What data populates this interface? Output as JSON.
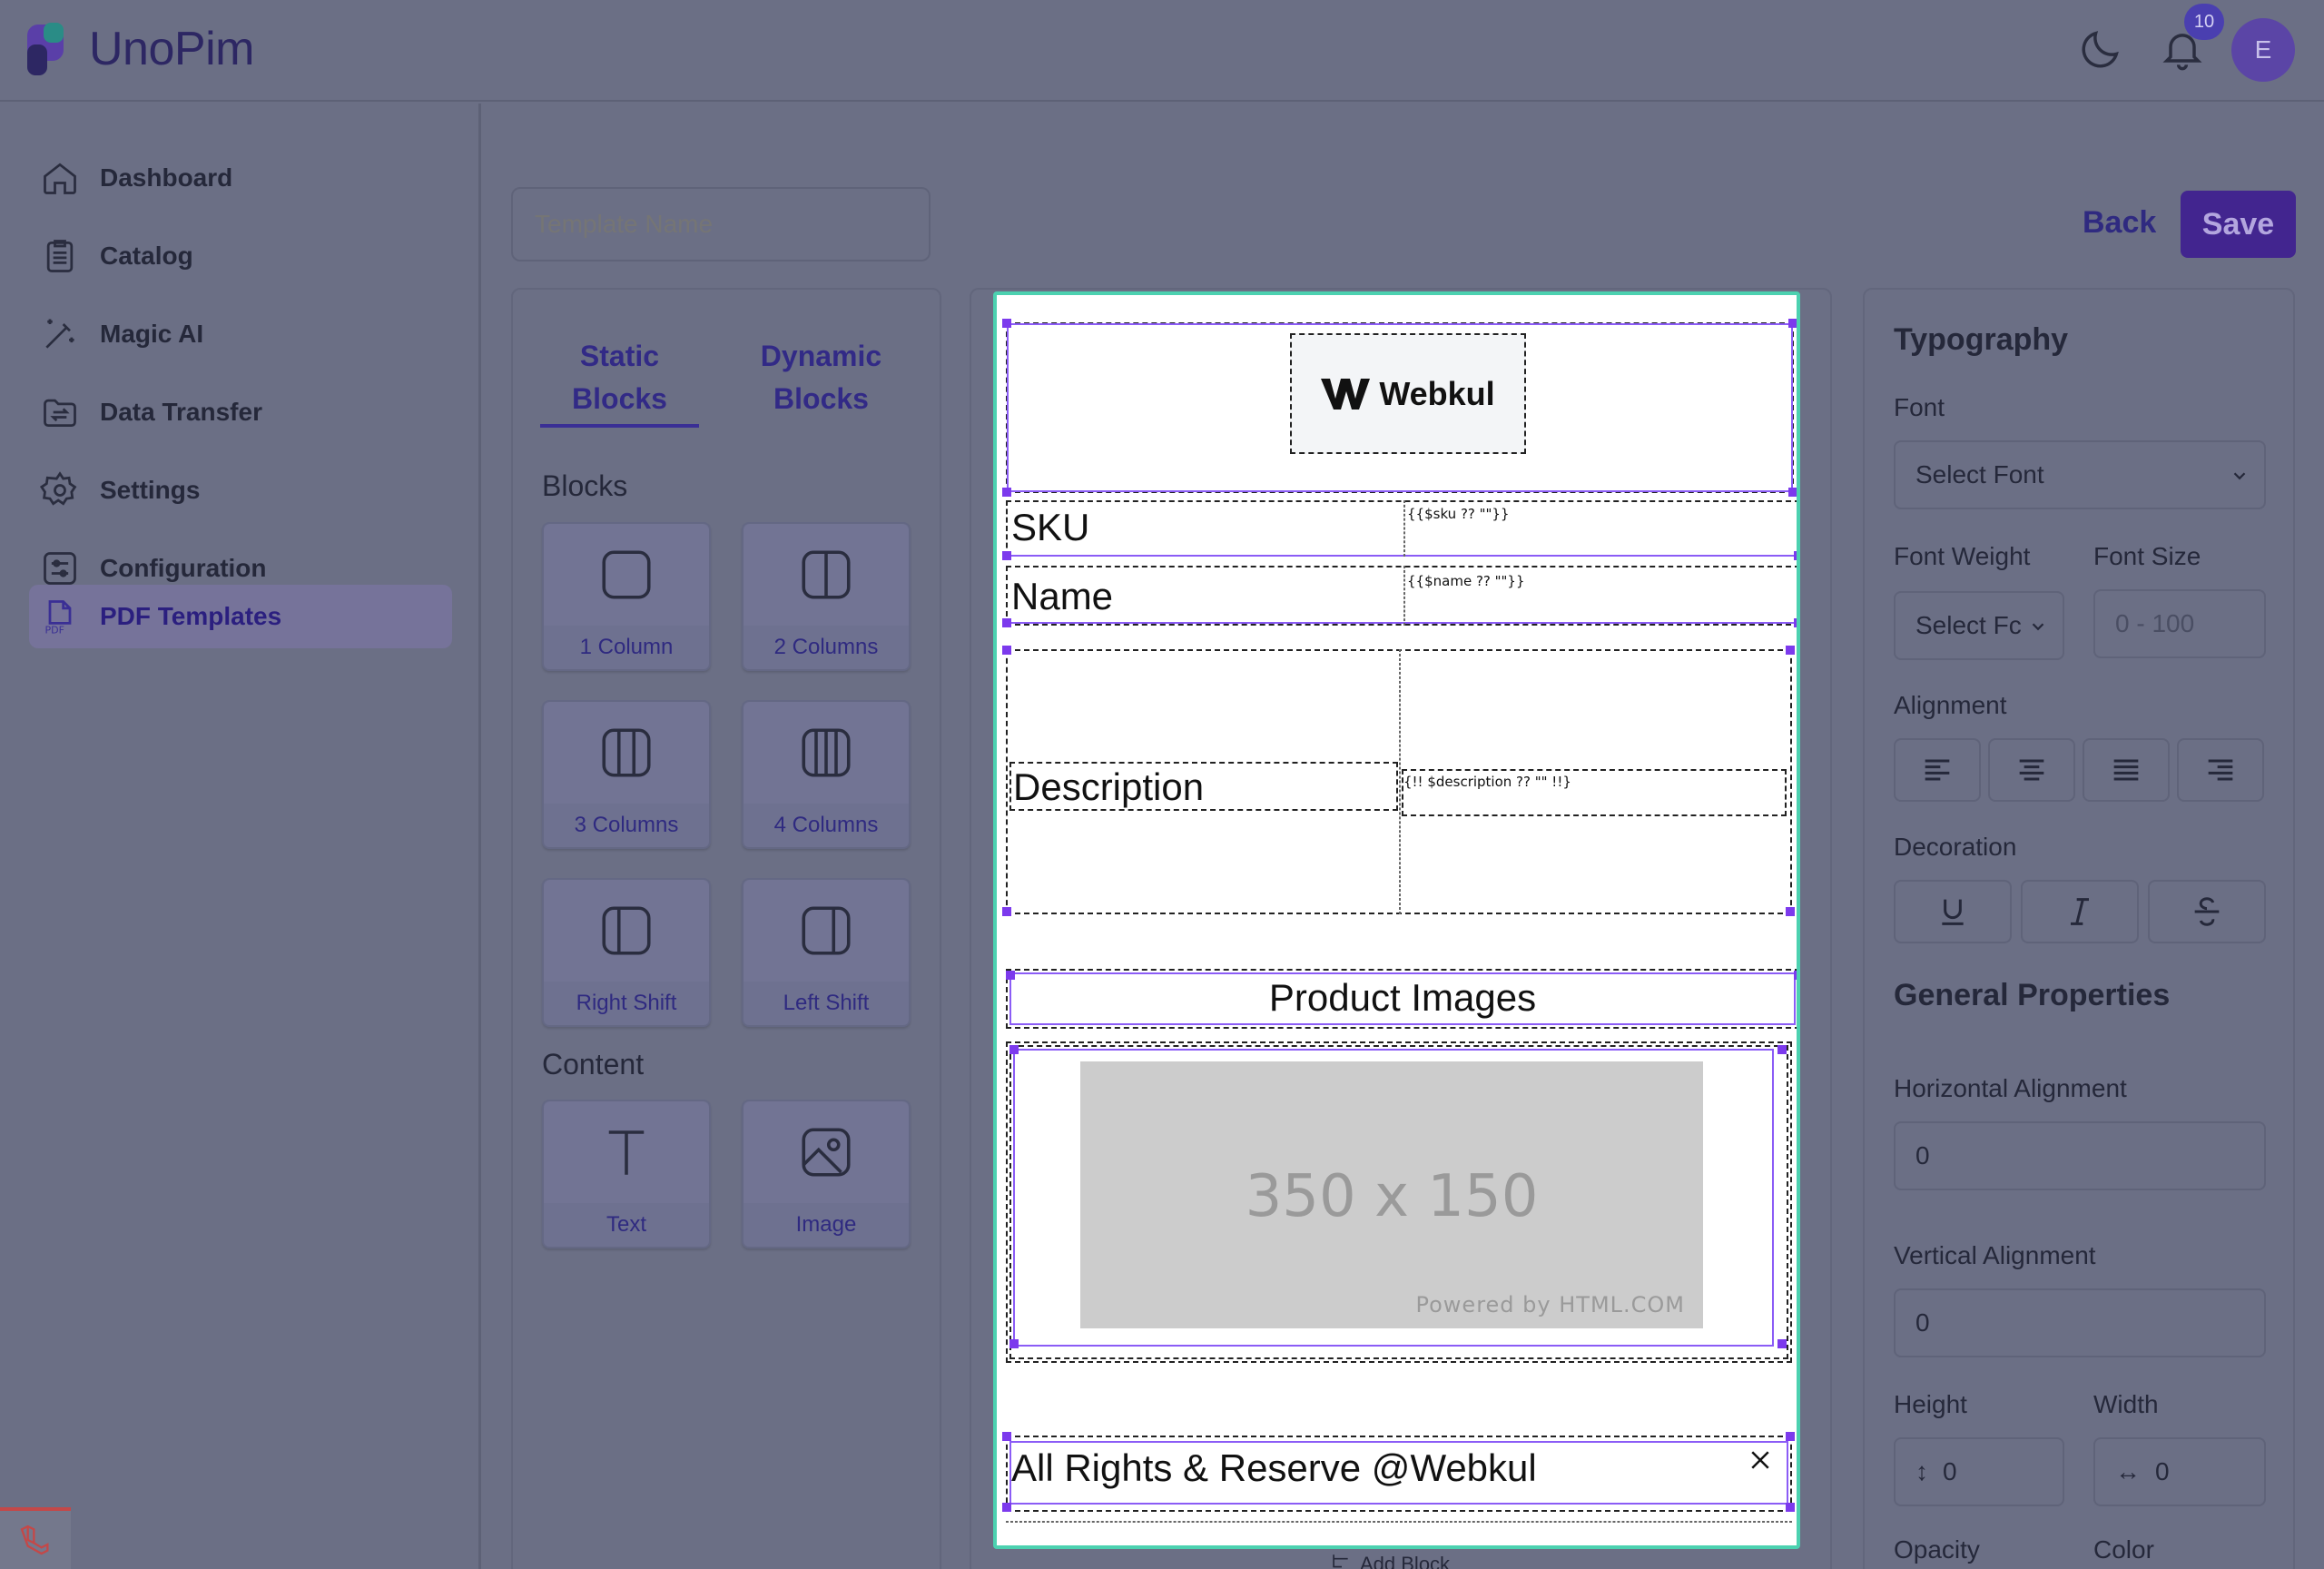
{
  "app": {
    "name": "UnoPim",
    "notification_count": "10",
    "avatar_initial": "E"
  },
  "sidebar": {
    "items": [
      {
        "label": "Dashboard",
        "icon": "home-icon"
      },
      {
        "label": "Catalog",
        "icon": "catalog-icon"
      },
      {
        "label": "Magic AI",
        "icon": "magic-wand-icon"
      },
      {
        "label": "Data Transfer",
        "icon": "data-transfer-icon"
      },
      {
        "label": "Settings",
        "icon": "gear-icon"
      },
      {
        "label": "Configuration",
        "icon": "sliders-icon"
      },
      {
        "label": "PDF Templates",
        "icon": "pdf-icon",
        "active": true
      }
    ]
  },
  "toolbar": {
    "template_name_placeholder": "Template Name",
    "back_label": "Back",
    "save_label": "Save"
  },
  "blocks_panel": {
    "tabs": [
      {
        "label": "Static Blocks",
        "active": true
      },
      {
        "label": "Dynamic Blocks",
        "active": false
      }
    ],
    "blocks_title": "Blocks",
    "blocks": [
      {
        "label": "1 Column"
      },
      {
        "label": "2 Columns"
      },
      {
        "label": "3 Columns"
      },
      {
        "label": "4 Columns"
      },
      {
        "label": "Right Shift"
      },
      {
        "label": "Left Shift"
      }
    ],
    "content_title": "Content",
    "content": [
      {
        "label": "Text"
      },
      {
        "label": "Image"
      }
    ]
  },
  "canvas": {
    "logo_text": "Webkul",
    "rows": [
      {
        "label": "SKU",
        "value": "{{$sku ?? \"\"}}"
      },
      {
        "label": "Name",
        "value": "{{$name ?? \"\"}}"
      },
      {
        "label": "Description",
        "value": "{!! $description ?? \"\" !!}"
      }
    ],
    "images_heading": "Product Images",
    "placeholder_image": {
      "size_text": "350 x 150",
      "powered_by": "Powered by HTML.COM"
    },
    "footer_text": "All Rights & Reserve @Webkul",
    "add_block_label": "Add Block"
  },
  "properties": {
    "typography_title": "Typography",
    "font_label": "Font",
    "font_select": "Select Font",
    "font_weight_label": "Font Weight",
    "font_weight_select": "Select Fc",
    "font_size_label": "Font Size",
    "font_size_placeholder": "0 - 100",
    "alignment_label": "Alignment",
    "decoration_label": "Decoration",
    "general_title": "General Properties",
    "h_align_label": "Horizontal Alignment",
    "h_align_value": "0",
    "v_align_label": "Vertical Alignment",
    "v_align_value": "0",
    "height_label": "Height",
    "height_value": "0",
    "width_label": "Width",
    "width_value": "0",
    "opacity_label": "Opacity",
    "color_label": "Color"
  }
}
